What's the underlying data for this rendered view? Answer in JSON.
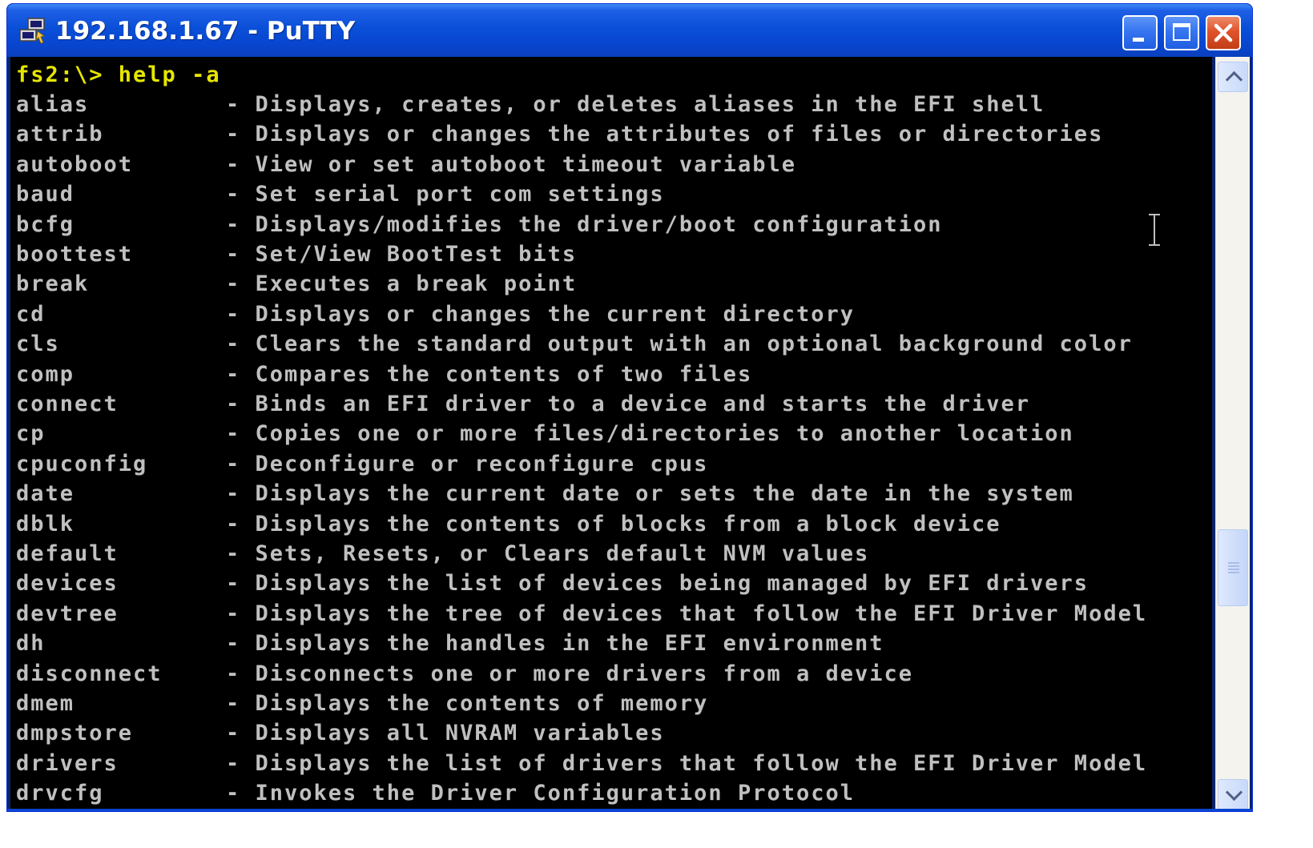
{
  "window": {
    "title": "192.168.1.67 - PuTTY",
    "icon": "putty-icon",
    "controls": [
      "minimize-icon",
      "maximize-icon",
      "close-icon"
    ]
  },
  "terminal": {
    "prompt": "fs2:\\> help -a",
    "lines": [
      {
        "cmd": "alias",
        "desc": "- Displays, creates, or deletes aliases in the EFI shell"
      },
      {
        "cmd": "attrib",
        "desc": "- Displays or changes the attributes of files or directories"
      },
      {
        "cmd": "autoboot",
        "desc": "- View or set autoboot timeout variable"
      },
      {
        "cmd": "baud",
        "desc": "- Set serial port com settings"
      },
      {
        "cmd": "bcfg",
        "desc": "- Displays/modifies the driver/boot configuration"
      },
      {
        "cmd": "boottest",
        "desc": "- Set/View BootTest bits"
      },
      {
        "cmd": "break",
        "desc": "- Executes a break point"
      },
      {
        "cmd": "cd",
        "desc": "- Displays or changes the current directory"
      },
      {
        "cmd": "cls",
        "desc": "- Clears the standard output with an optional background color"
      },
      {
        "cmd": "comp",
        "desc": "- Compares the contents of two files"
      },
      {
        "cmd": "connect",
        "desc": "- Binds an EFI driver to a device and starts the driver"
      },
      {
        "cmd": "cp",
        "desc": "- Copies one or more files/directories to another location"
      },
      {
        "cmd": "cpuconfig",
        "desc": "- Deconfigure or reconfigure cpus"
      },
      {
        "cmd": "date",
        "desc": "- Displays the current date or sets the date in the system"
      },
      {
        "cmd": "dblk",
        "desc": "- Displays the contents of blocks from a block device"
      },
      {
        "cmd": "default",
        "desc": "- Sets, Resets, or Clears default NVM values"
      },
      {
        "cmd": "devices",
        "desc": "- Displays the list of devices being managed by EFI drivers"
      },
      {
        "cmd": "devtree",
        "desc": "- Displays the tree of devices that follow the EFI Driver Model"
      },
      {
        "cmd": "dh",
        "desc": "- Displays the handles in the EFI environment"
      },
      {
        "cmd": "disconnect",
        "desc": "- Disconnects one or more drivers from a device"
      },
      {
        "cmd": "dmem",
        "desc": "- Displays the contents of memory"
      },
      {
        "cmd": "dmpstore",
        "desc": "- Displays all NVRAM variables"
      },
      {
        "cmd": "drivers",
        "desc": "- Displays the list of drivers that follow the EFI Driver Model"
      },
      {
        "cmd": "drvcfg",
        "desc": "- Invokes the Driver Configuration Protocol"
      }
    ]
  },
  "colors": {
    "background": "#000000",
    "text": "#c0c0c0",
    "prompt": "#e6e600",
    "titlebar": "#0a4fd8"
  },
  "scrollbar": {
    "position_fraction": 0.67
  }
}
